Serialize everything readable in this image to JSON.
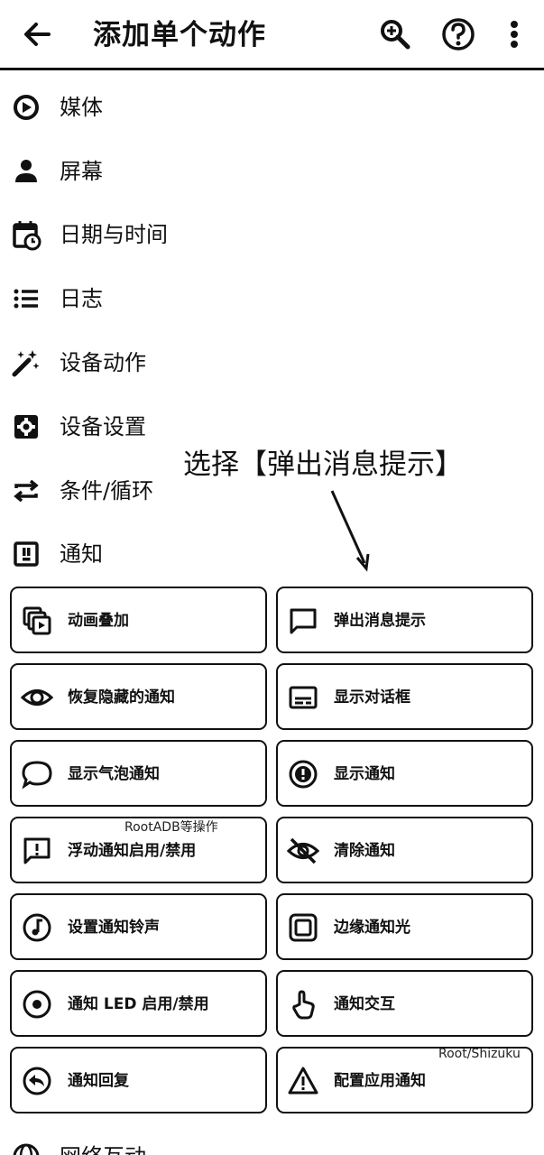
{
  "appbar": {
    "title": "添加单个动作"
  },
  "categories": [
    {
      "label": "媒体"
    },
    {
      "label": "屏幕"
    },
    {
      "label": "日期与时间"
    },
    {
      "label": "日志"
    },
    {
      "label": "设备动作"
    },
    {
      "label": "设备设置"
    },
    {
      "label": "条件/循环"
    },
    {
      "label": "通知"
    },
    {
      "label": "网络互动"
    }
  ],
  "actions": [
    {
      "label": "动画叠加",
      "icon": "stacked-image-icon"
    },
    {
      "label": "弹出消息提示",
      "icon": "message-bubble-icon"
    },
    {
      "label": "恢复隐藏的通知",
      "icon": "eye-icon"
    },
    {
      "label": "显示对话框",
      "icon": "dialog-icon"
    },
    {
      "label": "显示气泡通知",
      "icon": "chat-bubble-icon"
    },
    {
      "label": "显示通知",
      "icon": "notification-alert-icon"
    },
    {
      "label": "浮动通知启用/禁用",
      "icon": "floating-alert-icon"
    },
    {
      "label": "清除通知",
      "icon": "eye-off-icon"
    },
    {
      "label": "设置通知铃声",
      "icon": "music-note-icon"
    },
    {
      "label": "边缘通知光",
      "icon": "edge-light-icon"
    },
    {
      "label": "通知 LED 启用/禁用",
      "icon": "led-icon"
    },
    {
      "label": "通知交互",
      "icon": "touch-hand-icon"
    },
    {
      "label": "通知回复",
      "icon": "reply-icon"
    },
    {
      "label": "配置应用通知",
      "icon": "warning-icon"
    }
  ],
  "annotation": {
    "text": "选择【弹出消息提示】"
  },
  "watermarks": {
    "first": "RootADB等操作",
    "second": "Root/Shizuku"
  }
}
